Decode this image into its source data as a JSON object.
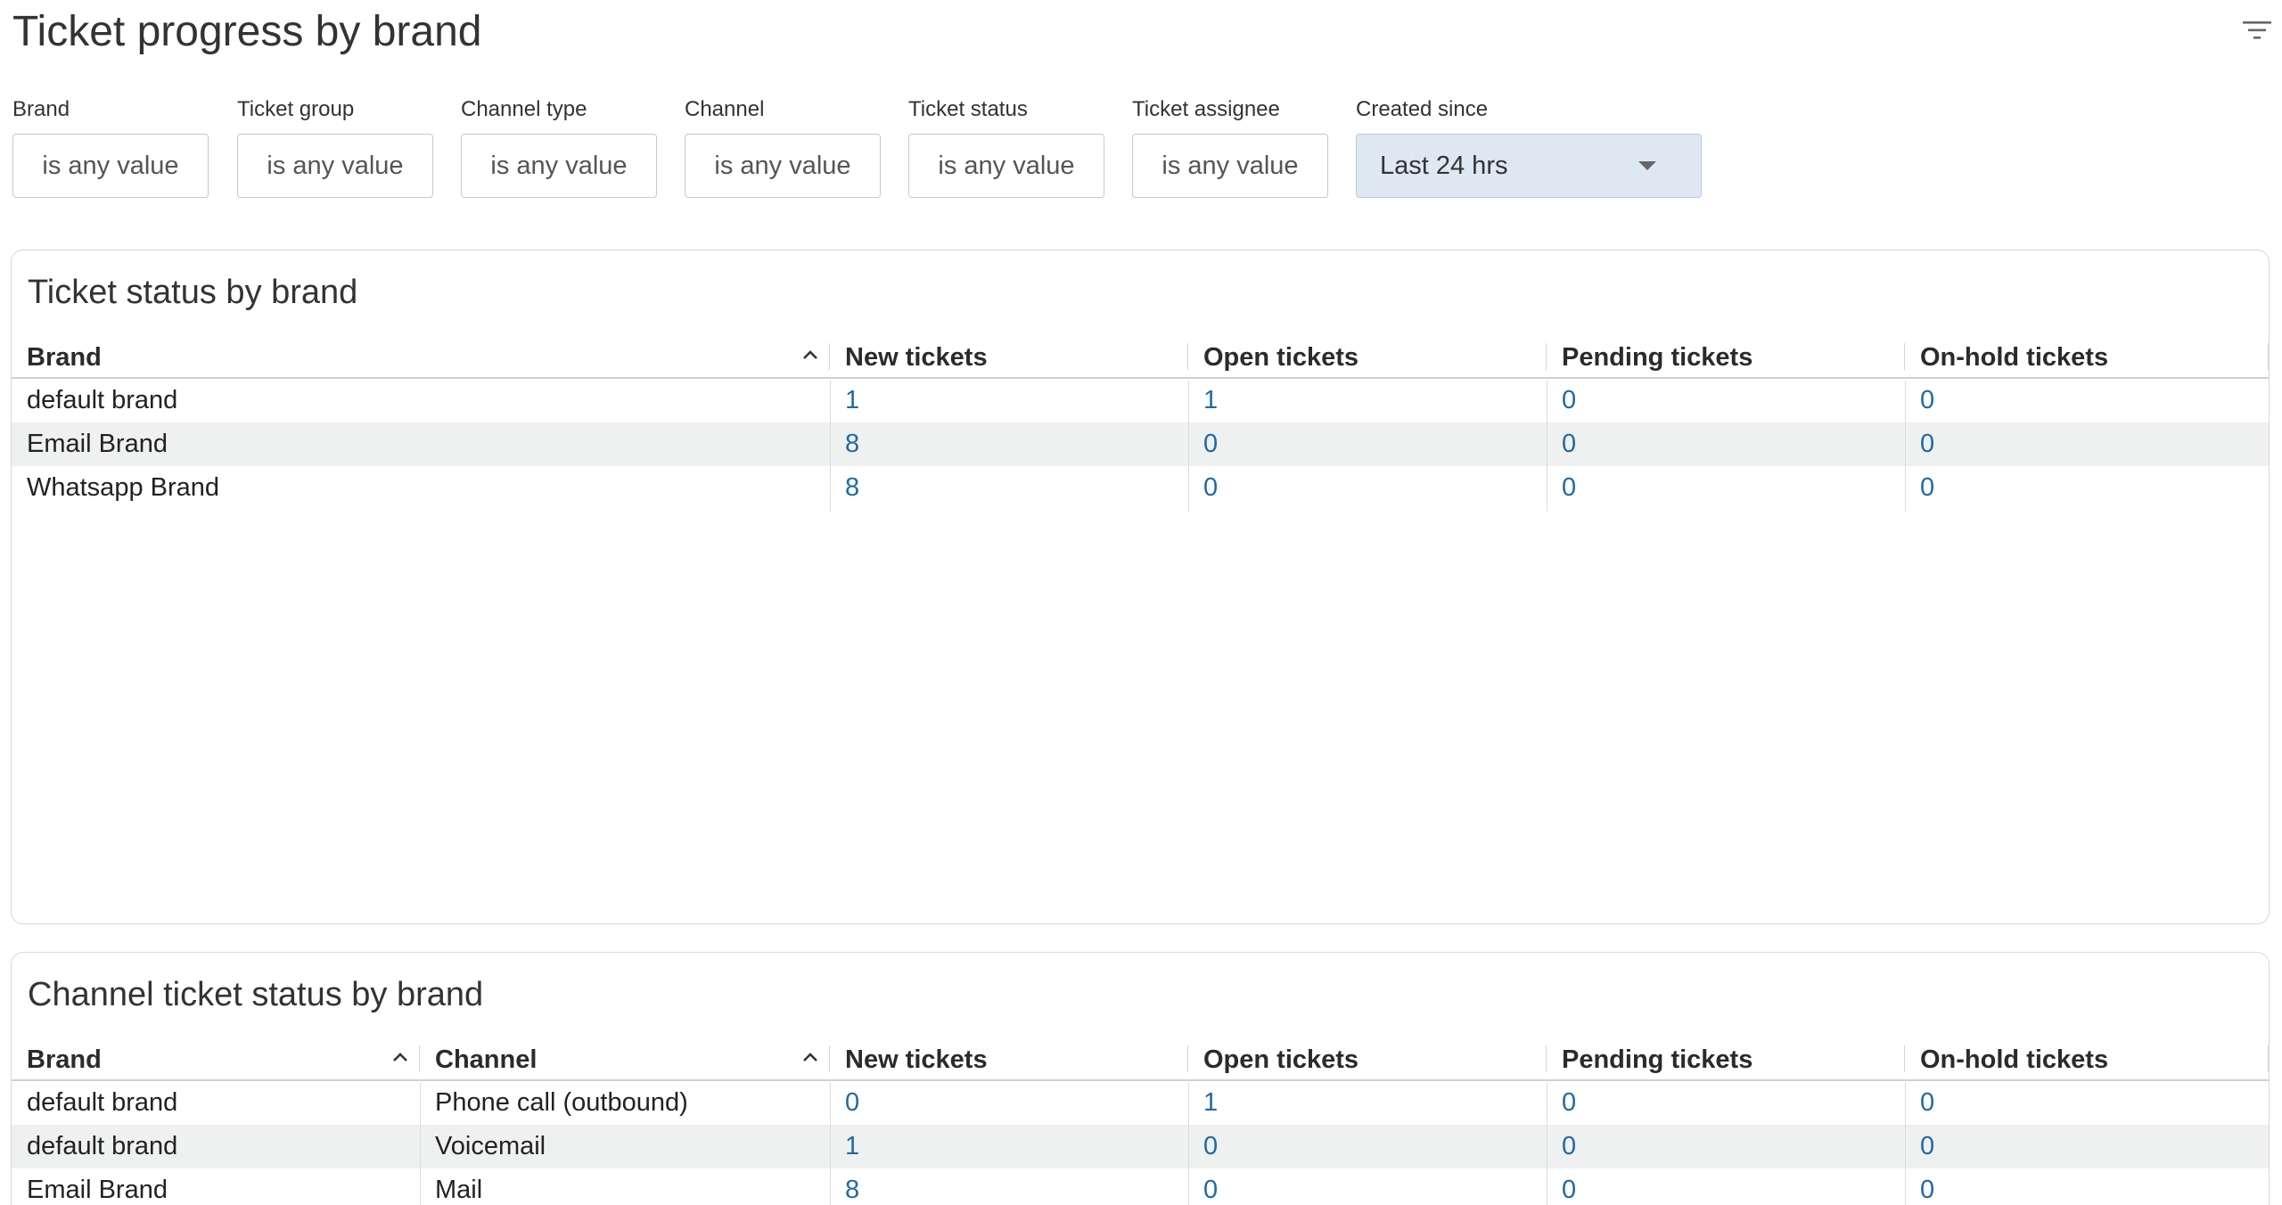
{
  "header": {
    "title": "Ticket progress by brand"
  },
  "filters": [
    {
      "label": "Brand",
      "value": "is any value"
    },
    {
      "label": "Ticket group",
      "value": "is any value"
    },
    {
      "label": "Channel type",
      "value": "is any value"
    },
    {
      "label": "Channel",
      "value": "is any value"
    },
    {
      "label": "Ticket status",
      "value": "is any value"
    },
    {
      "label": "Ticket assignee",
      "value": "is any value"
    },
    {
      "label": "Created since",
      "value": "Last 24 hrs"
    }
  ],
  "panel1": {
    "title": "Ticket status by brand",
    "columns": [
      "Brand",
      "New tickets",
      "Open tickets",
      "Pending tickets",
      "On-hold tickets"
    ],
    "rows": [
      [
        "default brand",
        "1",
        "1",
        "0",
        "0"
      ],
      [
        "Email Brand",
        "8",
        "0",
        "0",
        "0"
      ],
      [
        "Whatsapp Brand",
        "8",
        "0",
        "0",
        "0"
      ]
    ]
  },
  "panel2": {
    "title": "Channel ticket status by brand",
    "columns": [
      "Brand",
      "Channel",
      "New tickets",
      "Open tickets",
      "Pending tickets",
      "On-hold tickets"
    ],
    "rows": [
      [
        "default brand",
        "Phone call (outbound)",
        "0",
        "1",
        "0",
        "0"
      ],
      [
        "default brand",
        "Voicemail",
        "1",
        "0",
        "0",
        "0"
      ],
      [
        "Email Brand",
        "Mail",
        "8",
        "0",
        "0",
        "0"
      ]
    ]
  },
  "colors": {
    "link": "#1f6aa5",
    "row_alt": "#eff0f0",
    "select_bg": "#dde8f3"
  }
}
